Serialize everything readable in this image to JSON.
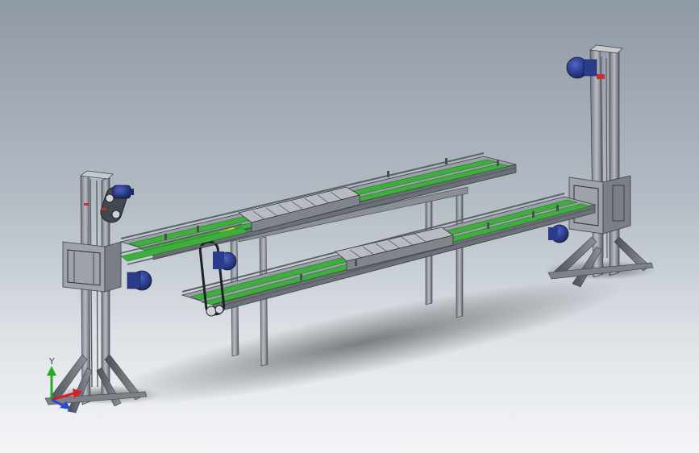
{
  "view": {
    "background_top": "#8f99a5",
    "background_bottom": "#f4f5f7"
  },
  "model": {
    "frame_color": "#8a8f96",
    "belt_color": "#3fae3f",
    "motor_color": "#2a3c8c"
  },
  "triad": {
    "y_label": "Y",
    "x_color": "#d42020",
    "y_color": "#2aa82a",
    "z_color": "#2a4ad4"
  }
}
